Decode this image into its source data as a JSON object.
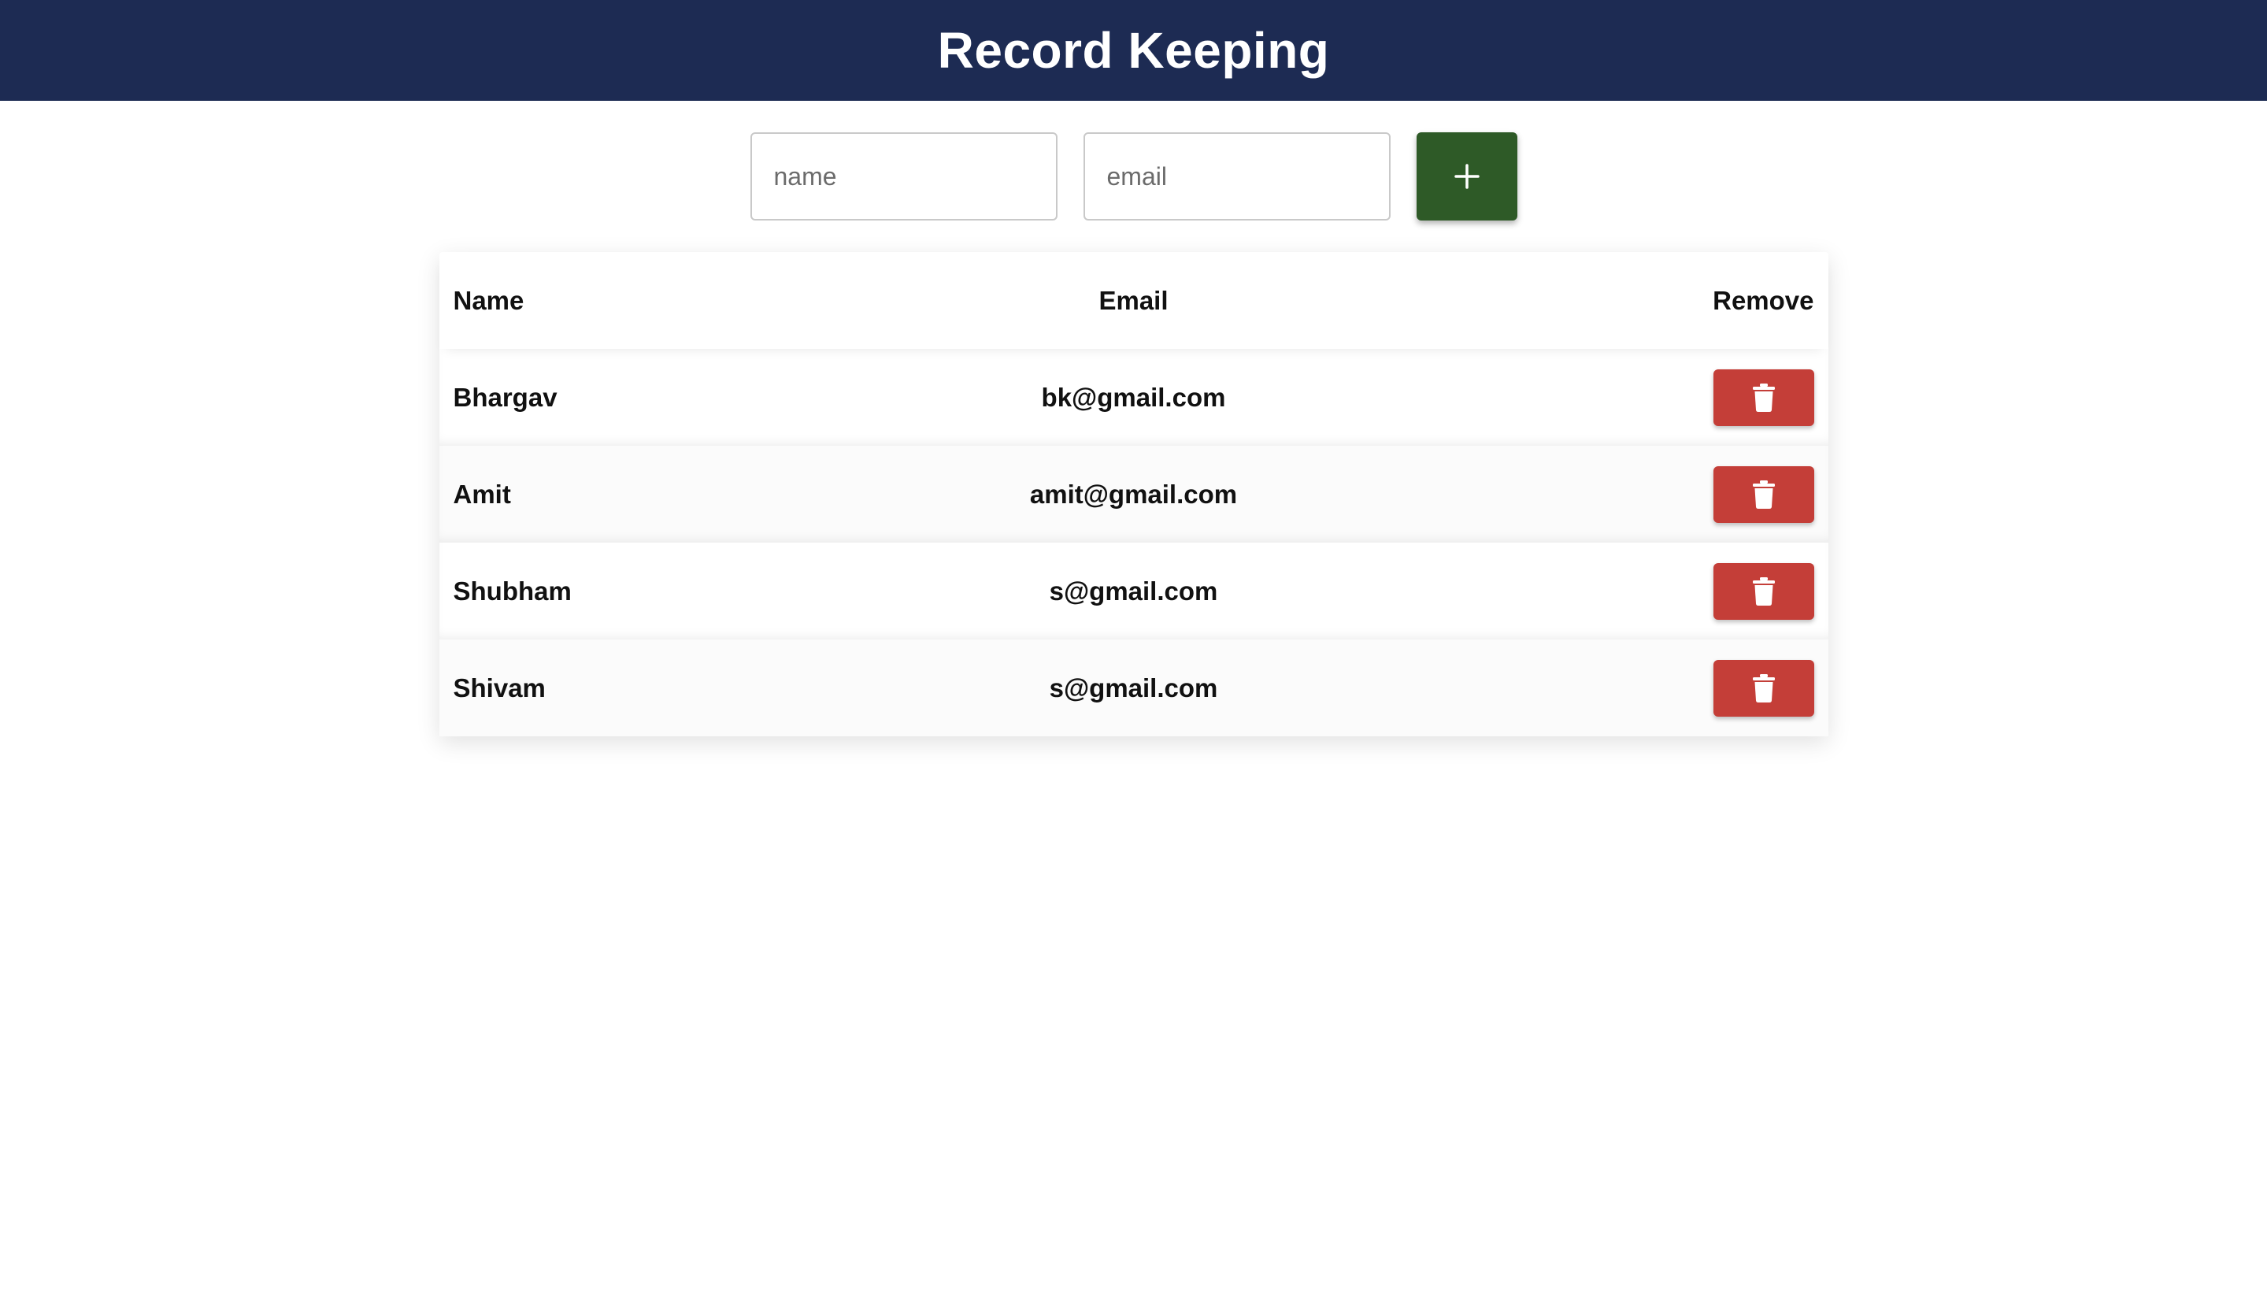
{
  "header": {
    "title": "Record Keeping",
    "background_color": "#1d2b53"
  },
  "form": {
    "name_placeholder": "name",
    "email_placeholder": "email",
    "add_button_icon": "plus-icon",
    "add_button_color": "#2e5a27"
  },
  "table": {
    "columns": [
      "Name",
      "Email",
      "Remove"
    ],
    "rows": [
      {
        "name": "Bhargav",
        "email": "bk@gmail.com"
      },
      {
        "name": "Amit",
        "email": "amit@gmail.com"
      },
      {
        "name": "Shubham",
        "email": "s@gmail.com"
      },
      {
        "name": "Shivam",
        "email": "s@gmail.com"
      }
    ],
    "delete_button_icon": "trash-icon",
    "delete_button_color": "#c43e38"
  }
}
